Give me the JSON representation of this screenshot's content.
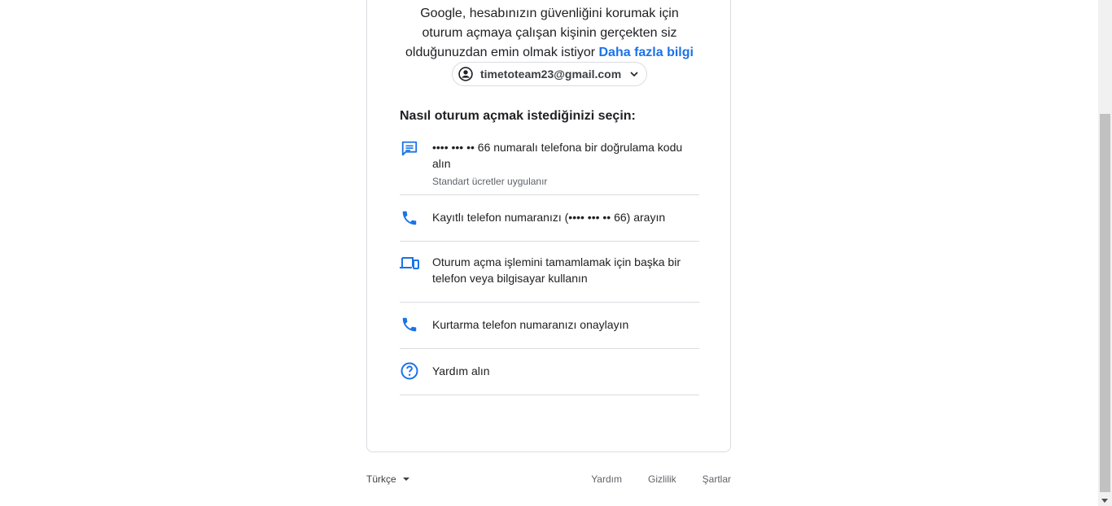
{
  "intro": {
    "line1": "Google, hesabınızın güvenliğini korumak için",
    "line2": "oturum açmaya çalışan kişinin gerçekten siz",
    "line3": "olduğunuzdan emin olmak istiyor",
    "learn_more": "Daha fazla bilgi"
  },
  "account": {
    "email": "timetoteam23@gmail.com",
    "avatar_icon": "account-circle-icon",
    "dropdown_icon": "chevron-down-icon"
  },
  "choose_title": "Nasıl oturum açmak istediğinizi seçin:",
  "options": [
    {
      "icon": "message-icon",
      "text": "•••• ••• •• 66 numaralı telefona bir doğrulama kodu alın",
      "sub": "Standart ücretler uygulanır"
    },
    {
      "icon": "phone-icon",
      "text": "Kayıtlı telefon numaranızı (•••• ••• •• 66) arayın"
    },
    {
      "icon": "devices-icon",
      "text": "Oturum açma işlemini tamamlamak için başka bir telefon veya bilgisayar kullanın"
    },
    {
      "icon": "phone-icon",
      "text": "Kurtarma telefon numaranızı onaylayın"
    },
    {
      "icon": "help-icon",
      "text": "Yardım alın"
    }
  ],
  "footer": {
    "language": "Türkçe",
    "help": "Yardım",
    "privacy": "Gizlilik",
    "terms": "Şartlar"
  },
  "colors": {
    "accent": "#1a73e8",
    "border": "#dadce0",
    "text": "#202124"
  }
}
